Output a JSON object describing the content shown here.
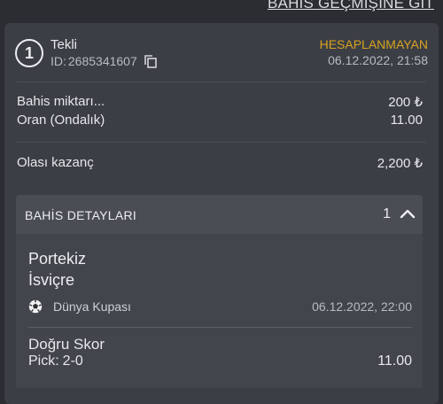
{
  "top_link": "BAHİS GEÇMİŞİNE GİT",
  "bet": {
    "badge": "1",
    "type": "Tekli",
    "id_label": "ID:",
    "id_value": "2685341607",
    "status": "HESAPLANMAYAN",
    "datetime": "06.12.2022, 21:58",
    "status_color": "#d8a321"
  },
  "summary": {
    "stake_label": "Bahis miktarı...",
    "stake_value": "200 ₺",
    "odds_label": "Oran (Ondalık)",
    "odds_value": "11.00",
    "potential_label": "Olası kazanç",
    "potential_value": "2,200 ₺"
  },
  "details": {
    "title": "BAHİS DETAYLARI",
    "count": "1",
    "expand_icon": "chevron-up-icon",
    "selection": {
      "home": "Portekiz",
      "away": "İsviçre",
      "league_icon": "football-icon",
      "league": "Dünya Kupası",
      "match_datetime": "06.12.2022, 22:00",
      "market": "Doğru Skor",
      "pick_label": "Pick:",
      "pick_value": "2-0",
      "odds": "11.00"
    }
  }
}
